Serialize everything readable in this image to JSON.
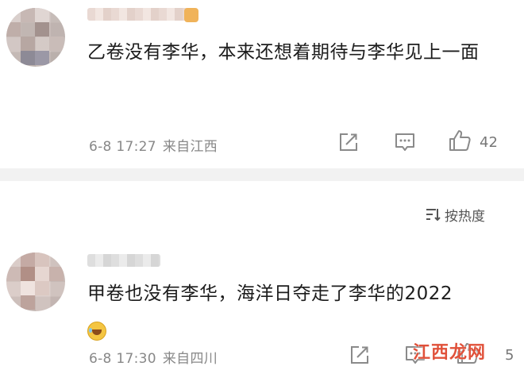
{
  "comments": [
    {
      "text": "乙卷没有李华，本来还想着期待与李华见上一面",
      "time": "6-8 17:27",
      "location": "来自江西",
      "likes": "42"
    },
    {
      "text": "甲卷也没有李华，海洋日夺走了李华的2022",
      "emoji": "laughing-tears-emoji",
      "time": "6-8 17:30",
      "location": "来自四川",
      "likes": "5"
    }
  ],
  "sort": {
    "label": "按热度"
  },
  "watermark": {
    "text": "江西龙网"
  },
  "colors": {
    "text": "#1c1c1c",
    "meta": "#888888",
    "divider": "#f2f2f2",
    "watermark": "#e0513a"
  }
}
